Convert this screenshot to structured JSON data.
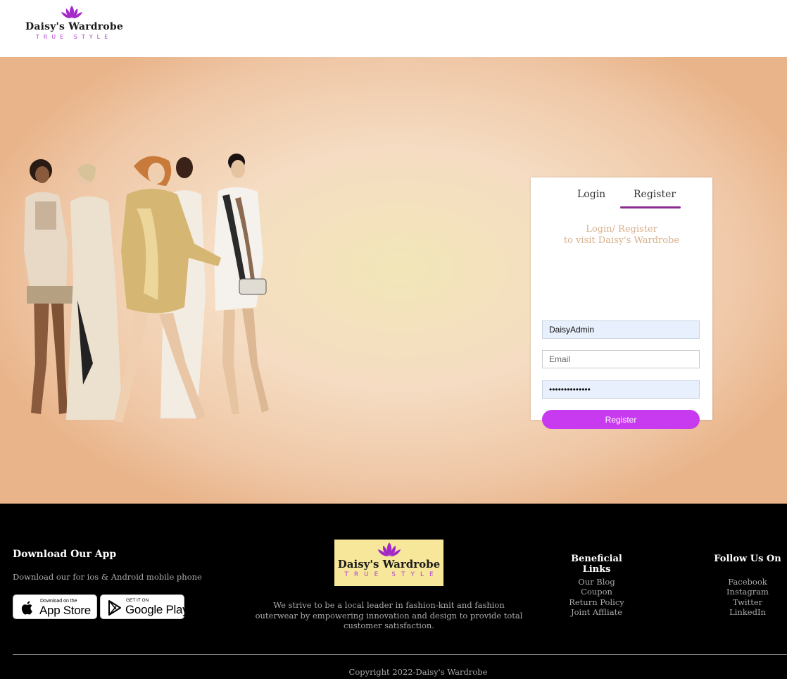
{
  "header": {
    "brand": "Daisy's Wardrobe",
    "tagline": "TRUE STYLE",
    "logo_icon": "lotus-icon"
  },
  "colors": {
    "accent": "#c83af0",
    "tab_underline": "#8b2c93",
    "subtitle": "#d7b08b",
    "footer_bg": "#000000",
    "footer_logo_bg": "#f7e79a"
  },
  "auth": {
    "tab_login": "Login",
    "tab_register": "Register",
    "active_tab": "Register",
    "subtitle_line1": "Login/ Register",
    "subtitle_line2": "to visit Daisy's Wardrobe",
    "username_value": "DaisyAdmin",
    "email_placeholder": "Email",
    "password_value": "••••••••••••••",
    "register_button": "Register"
  },
  "footer": {
    "app_title": "Download Our App",
    "app_text": "Download our for ios & Android mobile phone",
    "appstore_small": "Download on the",
    "appstore_big": "App Store",
    "gplay_small": "GET IT ON",
    "gplay_big": "Google Play",
    "logo_brand": "Daisy's Wardrobe",
    "logo_tagline": "TRUE STYLE",
    "mission": "We strive to be a local leader in fashion-knit and fashion outerwear by empowering innovation and design to provide total customer satisfaction.",
    "links_title": "Beneficial Links",
    "links": [
      "Our Blog",
      "Coupon",
      "Return Policy",
      "Joint Affliate"
    ],
    "social_title": "Follow Us On",
    "social": [
      "Facebook",
      "Instagram",
      "Twitter",
      "LinkedIn"
    ],
    "copyright": "Copyright 2022-Daisy's Wardrobe"
  }
}
